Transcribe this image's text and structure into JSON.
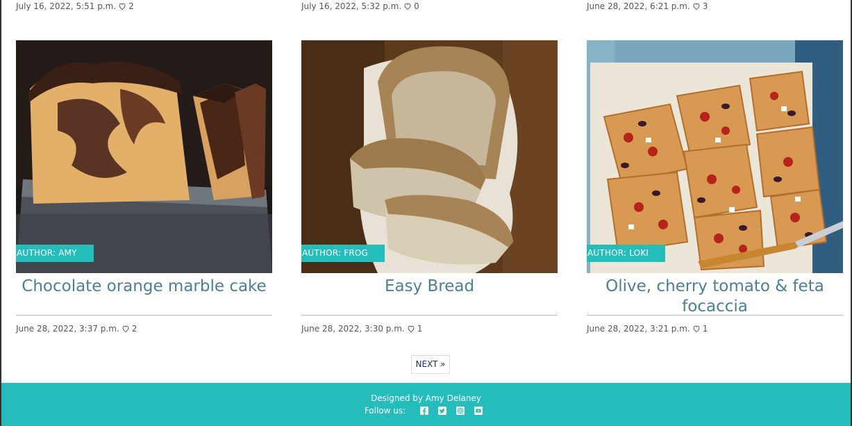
{
  "top_row_meta": [
    {
      "date": "July 16, 2022, 5:51 p.m.",
      "likes": "2"
    },
    {
      "date": "July 16, 2022, 5:32 p.m.",
      "likes": "0"
    },
    {
      "date": "June 28, 2022, 6:21 p.m.",
      "likes": "3"
    }
  ],
  "cards": [
    {
      "author": "AUTHOR: AMY",
      "title": "Chocolate orange marble cake",
      "date": "June 28, 2022, 3:37 p.m.",
      "likes": "2"
    },
    {
      "author": "AUTHOR: FROG",
      "title": "Easy Bread",
      "date": "June 28, 2022, 3:30 p.m.",
      "likes": "1"
    },
    {
      "author": "AUTHOR: LOKI",
      "title": "Olive, cherry tomato & feta focaccia",
      "date": "June 28, 2022, 3:21 p.m.",
      "likes": "1"
    }
  ],
  "pagination": {
    "next_label": "NEXT »"
  },
  "footer": {
    "credit": "Designed by Amy Delaney",
    "follow_label": "Follow us:",
    "social_icons": [
      "facebook-icon",
      "twitter-icon",
      "instagram-icon",
      "youtube-icon"
    ]
  },
  "colors": {
    "accent": "#25bcbc",
    "title": "#4b7f94",
    "meta": "#555555"
  }
}
